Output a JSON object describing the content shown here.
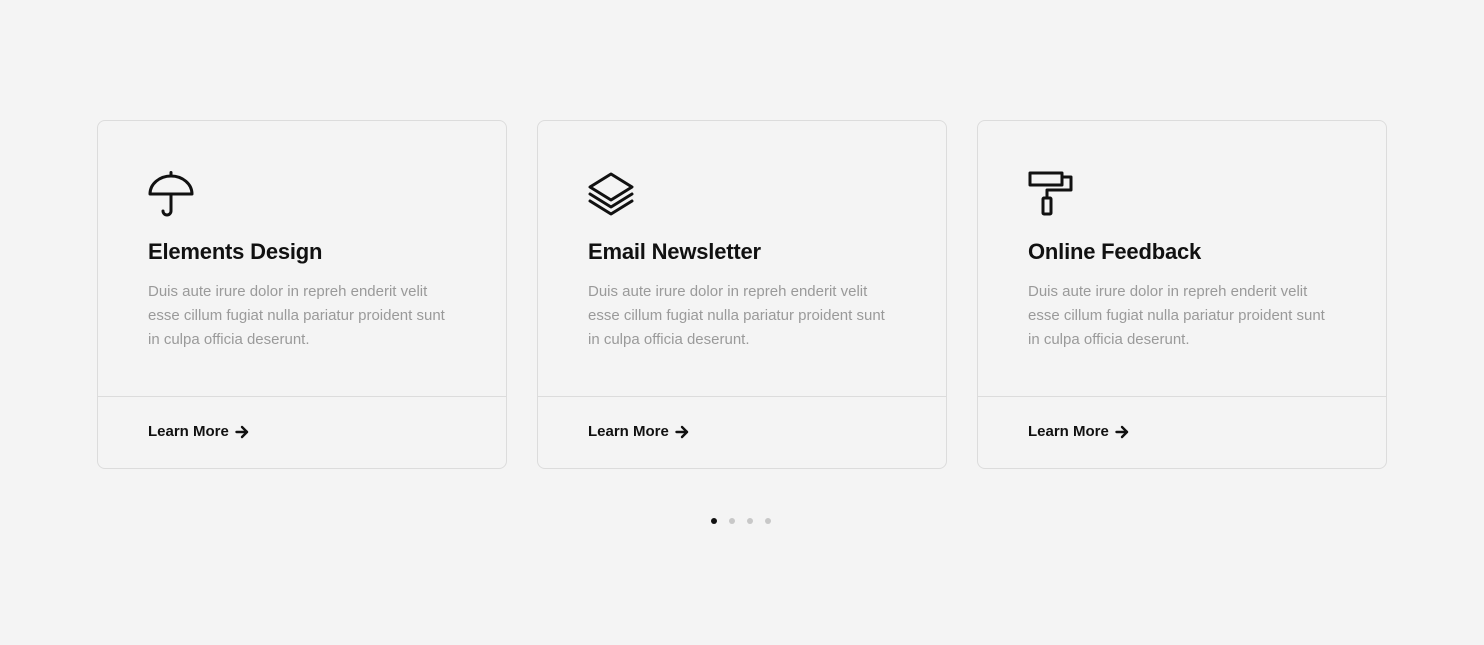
{
  "cards": [
    {
      "icon": "umbrella-icon",
      "title": "Elements Design",
      "description": "Duis aute irure dolor in repreh enderit velit esse cillum fugiat nulla pariatur proident sunt in culpa officia deserunt.",
      "link_label": "Learn More"
    },
    {
      "icon": "layers-icon",
      "title": "Email Newsletter",
      "description": "Duis aute irure dolor in repreh enderit velit esse cillum fugiat nulla pariatur proident sunt in culpa officia deserunt.",
      "link_label": "Learn More"
    },
    {
      "icon": "paint-roller-icon",
      "title": "Online Feedback",
      "description": "Duis aute irure dolor in repreh enderit velit esse cillum fugiat nulla pariatur proident sunt in culpa officia deserunt.",
      "link_label": "Learn More"
    }
  ],
  "pagination": {
    "total": 4,
    "active_index": 0
  },
  "colors": {
    "background": "#f4f4f4",
    "text": "#111111",
    "muted": "#9a9a9a",
    "border": "#dcdcdc",
    "dot_inactive": "#c8c8c8",
    "dot_active": "#111111"
  }
}
